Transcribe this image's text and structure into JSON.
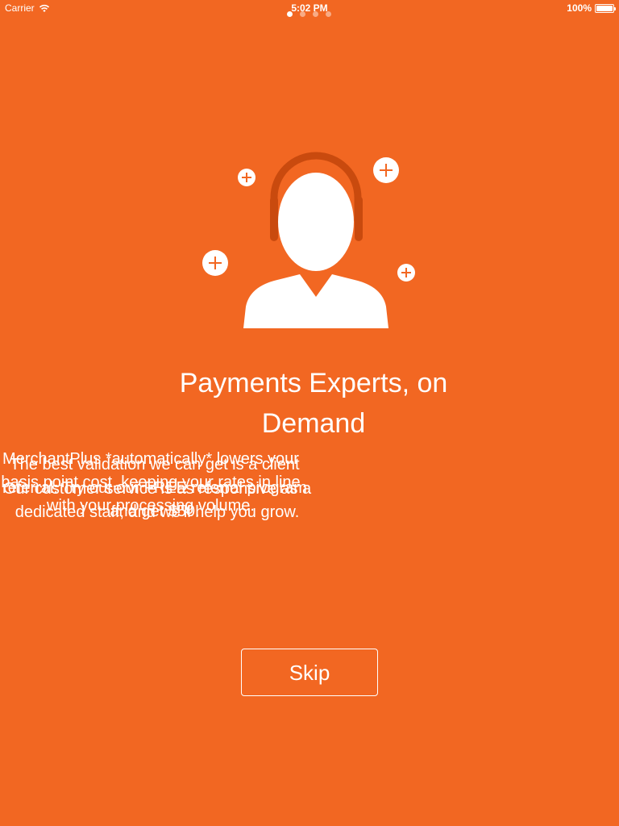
{
  "status_bar": {
    "carrier": "Carrier",
    "time": "5:02 PM",
    "battery": "100%"
  },
  "onboarding": {
    "page_count": 4,
    "active_page_index": 0,
    "icon": "headset-support-agent-icon",
    "title": "Payments Experts, on Demand",
    "overlapping_descriptions": [
      "MerchantPlus *automatically* lowers your basis point cost, keeping your rates in line with your processing volume.",
      "The best validation we can get is a client referral. Try out our FREE referral program and get $50.",
      "Our customer service is as responsive as a dedicated staff, and we'll help you grow."
    ]
  },
  "actions": {
    "skip_label": "Skip"
  },
  "colors": {
    "background": "#F26722",
    "icon_accent": "#C94A0E",
    "foreground": "#FFFFFF"
  }
}
